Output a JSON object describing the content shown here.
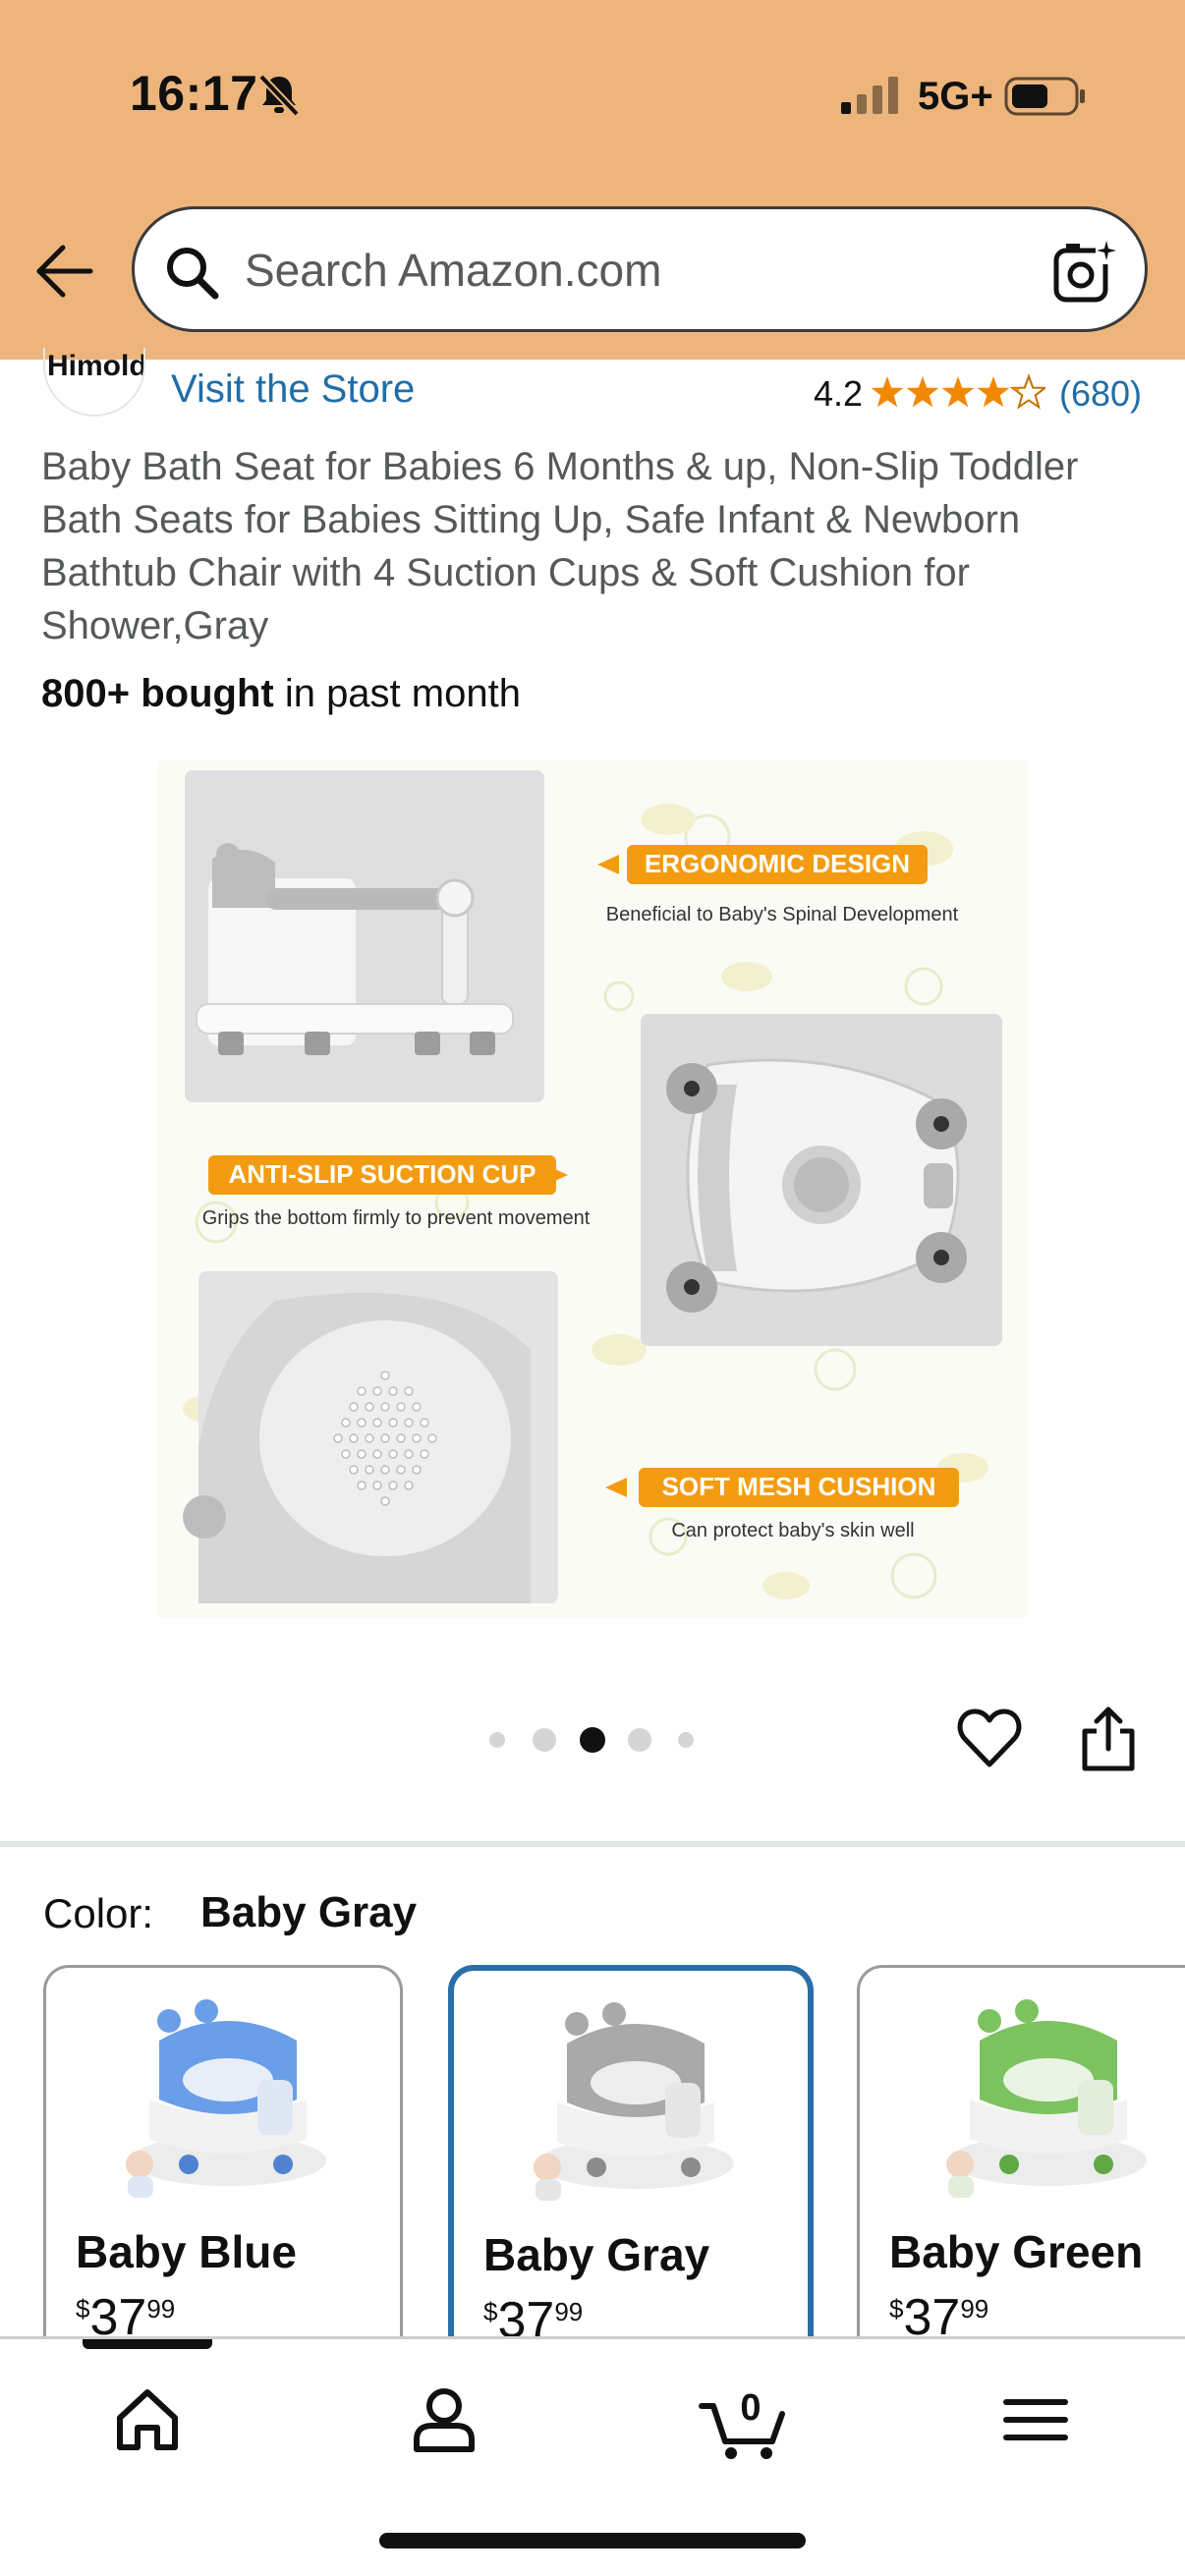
{
  "status_bar": {
    "time": "16:17",
    "network": "5G+",
    "icons": [
      "bell-slash-icon",
      "signal-icon",
      "battery-icon"
    ]
  },
  "search": {
    "placeholder": "Search Amazon.com",
    "icons": [
      "back-arrow-icon",
      "search-icon",
      "camera-lens-icon"
    ]
  },
  "store": {
    "brand": "Himold",
    "link_label": "Visit the Store",
    "rating": "4.2",
    "rating_value": 4.2,
    "rating_count": "(680)"
  },
  "product": {
    "title": "Baby Bath Seat for Babies 6 Months & up, Non-Slip Toddler Bath Seats for Babies Sitting Up, Safe Infant & Newborn Bathtub Chair with 4 Suction Cups & Soft Cushion for Shower,Gray",
    "bought_bold": "800+ bought",
    "bought_rest": " in past month",
    "image_callouts": [
      {
        "heading": "ERGONOMIC DESIGN",
        "text": "Beneficial to Baby's Spinal Development"
      },
      {
        "heading": "ANTI-SLIP SUCTION CUP",
        "text": "Grips the bottom firmly to prevent movement"
      },
      {
        "heading": "SOFT MESH CUSHION",
        "text": "Can protect baby's skin well"
      }
    ],
    "carousel": {
      "total": 5,
      "active_index": 2
    }
  },
  "actions": {
    "icons": [
      "heart-icon",
      "share-icon"
    ]
  },
  "color": {
    "label": "Color:",
    "selected": "Baby Gray",
    "options": [
      {
        "name": "Baby Blue",
        "currency": "$",
        "whole": "37",
        "fraction": "99",
        "accent": "#6b9ee8"
      },
      {
        "name": "Baby Gray",
        "currency": "$",
        "whole": "37",
        "fraction": "99",
        "accent": "#a9a9a9"
      },
      {
        "name": "Baby Green",
        "currency": "$",
        "whole": "37",
        "fraction": "99",
        "accent": "#7cc35f"
      }
    ]
  },
  "bottom_nav": {
    "items": [
      "home-icon",
      "account-icon",
      "cart-icon",
      "menu-icon"
    ],
    "cart_count": "0"
  },
  "colors": {
    "header_bg": "#edb57c",
    "link": "#1f6ea8",
    "star": "#f08804",
    "callout": "#f39c12",
    "selected_border": "#2a6ea9"
  }
}
